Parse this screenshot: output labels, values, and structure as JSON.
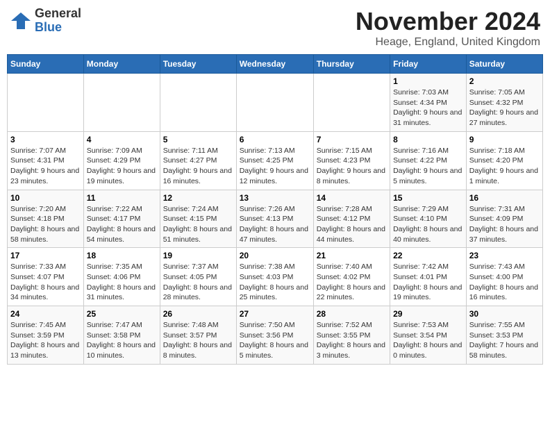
{
  "logo": {
    "general": "General",
    "blue": "Blue"
  },
  "header": {
    "month": "November 2024",
    "location": "Heage, England, United Kingdom"
  },
  "weekdays": [
    "Sunday",
    "Monday",
    "Tuesday",
    "Wednesday",
    "Thursday",
    "Friday",
    "Saturday"
  ],
  "weeks": [
    [
      {
        "day": "",
        "info": ""
      },
      {
        "day": "",
        "info": ""
      },
      {
        "day": "",
        "info": ""
      },
      {
        "day": "",
        "info": ""
      },
      {
        "day": "",
        "info": ""
      },
      {
        "day": "1",
        "info": "Sunrise: 7:03 AM\nSunset: 4:34 PM\nDaylight: 9 hours and 31 minutes."
      },
      {
        "day": "2",
        "info": "Sunrise: 7:05 AM\nSunset: 4:32 PM\nDaylight: 9 hours and 27 minutes."
      }
    ],
    [
      {
        "day": "3",
        "info": "Sunrise: 7:07 AM\nSunset: 4:31 PM\nDaylight: 9 hours and 23 minutes."
      },
      {
        "day": "4",
        "info": "Sunrise: 7:09 AM\nSunset: 4:29 PM\nDaylight: 9 hours and 19 minutes."
      },
      {
        "day": "5",
        "info": "Sunrise: 7:11 AM\nSunset: 4:27 PM\nDaylight: 9 hours and 16 minutes."
      },
      {
        "day": "6",
        "info": "Sunrise: 7:13 AM\nSunset: 4:25 PM\nDaylight: 9 hours and 12 minutes."
      },
      {
        "day": "7",
        "info": "Sunrise: 7:15 AM\nSunset: 4:23 PM\nDaylight: 9 hours and 8 minutes."
      },
      {
        "day": "8",
        "info": "Sunrise: 7:16 AM\nSunset: 4:22 PM\nDaylight: 9 hours and 5 minutes."
      },
      {
        "day": "9",
        "info": "Sunrise: 7:18 AM\nSunset: 4:20 PM\nDaylight: 9 hours and 1 minute."
      }
    ],
    [
      {
        "day": "10",
        "info": "Sunrise: 7:20 AM\nSunset: 4:18 PM\nDaylight: 8 hours and 58 minutes."
      },
      {
        "day": "11",
        "info": "Sunrise: 7:22 AM\nSunset: 4:17 PM\nDaylight: 8 hours and 54 minutes."
      },
      {
        "day": "12",
        "info": "Sunrise: 7:24 AM\nSunset: 4:15 PM\nDaylight: 8 hours and 51 minutes."
      },
      {
        "day": "13",
        "info": "Sunrise: 7:26 AM\nSunset: 4:13 PM\nDaylight: 8 hours and 47 minutes."
      },
      {
        "day": "14",
        "info": "Sunrise: 7:28 AM\nSunset: 4:12 PM\nDaylight: 8 hours and 44 minutes."
      },
      {
        "day": "15",
        "info": "Sunrise: 7:29 AM\nSunset: 4:10 PM\nDaylight: 8 hours and 40 minutes."
      },
      {
        "day": "16",
        "info": "Sunrise: 7:31 AM\nSunset: 4:09 PM\nDaylight: 8 hours and 37 minutes."
      }
    ],
    [
      {
        "day": "17",
        "info": "Sunrise: 7:33 AM\nSunset: 4:07 PM\nDaylight: 8 hours and 34 minutes."
      },
      {
        "day": "18",
        "info": "Sunrise: 7:35 AM\nSunset: 4:06 PM\nDaylight: 8 hours and 31 minutes."
      },
      {
        "day": "19",
        "info": "Sunrise: 7:37 AM\nSunset: 4:05 PM\nDaylight: 8 hours and 28 minutes."
      },
      {
        "day": "20",
        "info": "Sunrise: 7:38 AM\nSunset: 4:03 PM\nDaylight: 8 hours and 25 minutes."
      },
      {
        "day": "21",
        "info": "Sunrise: 7:40 AM\nSunset: 4:02 PM\nDaylight: 8 hours and 22 minutes."
      },
      {
        "day": "22",
        "info": "Sunrise: 7:42 AM\nSunset: 4:01 PM\nDaylight: 8 hours and 19 minutes."
      },
      {
        "day": "23",
        "info": "Sunrise: 7:43 AM\nSunset: 4:00 PM\nDaylight: 8 hours and 16 minutes."
      }
    ],
    [
      {
        "day": "24",
        "info": "Sunrise: 7:45 AM\nSunset: 3:59 PM\nDaylight: 8 hours and 13 minutes."
      },
      {
        "day": "25",
        "info": "Sunrise: 7:47 AM\nSunset: 3:58 PM\nDaylight: 8 hours and 10 minutes."
      },
      {
        "day": "26",
        "info": "Sunrise: 7:48 AM\nSunset: 3:57 PM\nDaylight: 8 hours and 8 minutes."
      },
      {
        "day": "27",
        "info": "Sunrise: 7:50 AM\nSunset: 3:56 PM\nDaylight: 8 hours and 5 minutes."
      },
      {
        "day": "28",
        "info": "Sunrise: 7:52 AM\nSunset: 3:55 PM\nDaylight: 8 hours and 3 minutes."
      },
      {
        "day": "29",
        "info": "Sunrise: 7:53 AM\nSunset: 3:54 PM\nDaylight: 8 hours and 0 minutes."
      },
      {
        "day": "30",
        "info": "Sunrise: 7:55 AM\nSunset: 3:53 PM\nDaylight: 7 hours and 58 minutes."
      }
    ]
  ]
}
